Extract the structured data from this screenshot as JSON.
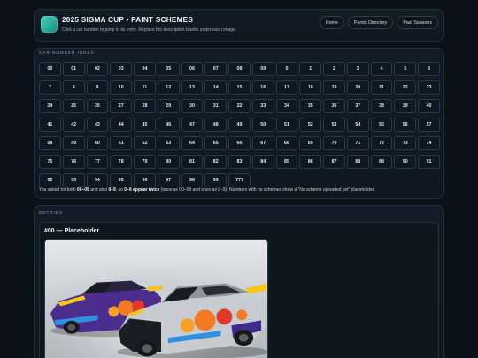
{
  "header": {
    "title": "2025 SIGMA CUP • PAINT SCHEMES",
    "subtitle": "Click a car number to jump to its entry. Replace the description blanks under each image.",
    "nav": [
      "Home",
      "Paints Directory",
      "Past Seasons"
    ]
  },
  "index": {
    "label": "CAR NUMBER INDEX",
    "numbers": [
      "00",
      "01",
      "02",
      "03",
      "04",
      "05",
      "06",
      "07",
      "08",
      "09",
      "0",
      "1",
      "2",
      "3",
      "4",
      "5",
      "6",
      "7",
      "8",
      "9",
      "10",
      "11",
      "12",
      "13",
      "14",
      "15",
      "16",
      "17",
      "18",
      "19",
      "20",
      "21",
      "22",
      "23",
      "24",
      "25",
      "26",
      "27",
      "28",
      "29",
      "30",
      "31",
      "32",
      "33",
      "34",
      "35",
      "36",
      "37",
      "38",
      "39",
      "40",
      "41",
      "42",
      "43",
      "44",
      "45",
      "46",
      "47",
      "48",
      "49",
      "50",
      "51",
      "52",
      "53",
      "54",
      "55",
      "56",
      "57",
      "58",
      "59",
      "60",
      "61",
      "62",
      "63",
      "64",
      "65",
      "66",
      "67",
      "68",
      "69",
      "70",
      "71",
      "72",
      "73",
      "74",
      "75",
      "76",
      "77",
      "78",
      "79",
      "80",
      "81",
      "82",
      "83",
      "84",
      "85",
      "86",
      "87",
      "88",
      "89",
      "90",
      "91",
      "92",
      "93",
      "94",
      "95",
      "96",
      "97",
      "98",
      "99",
      "777"
    ],
    "note": [
      "You asked for both ",
      "00–09",
      " and also ",
      "0–9",
      ", so ",
      "0–9 appear twice",
      " (once as 00–09 and once as 0–9). Numbers with no schemes show a “No scheme uploaded yet” placeholder."
    ]
  },
  "entries": {
    "label": "ENTRIES",
    "items": [
      {
        "title": "#00 — Placeholder"
      }
    ]
  },
  "colors": {
    "page_bg": "#0b1118",
    "card_bg": "#111a23",
    "accent": "#2fbfa6",
    "cell_bg": "#0e1820"
  }
}
